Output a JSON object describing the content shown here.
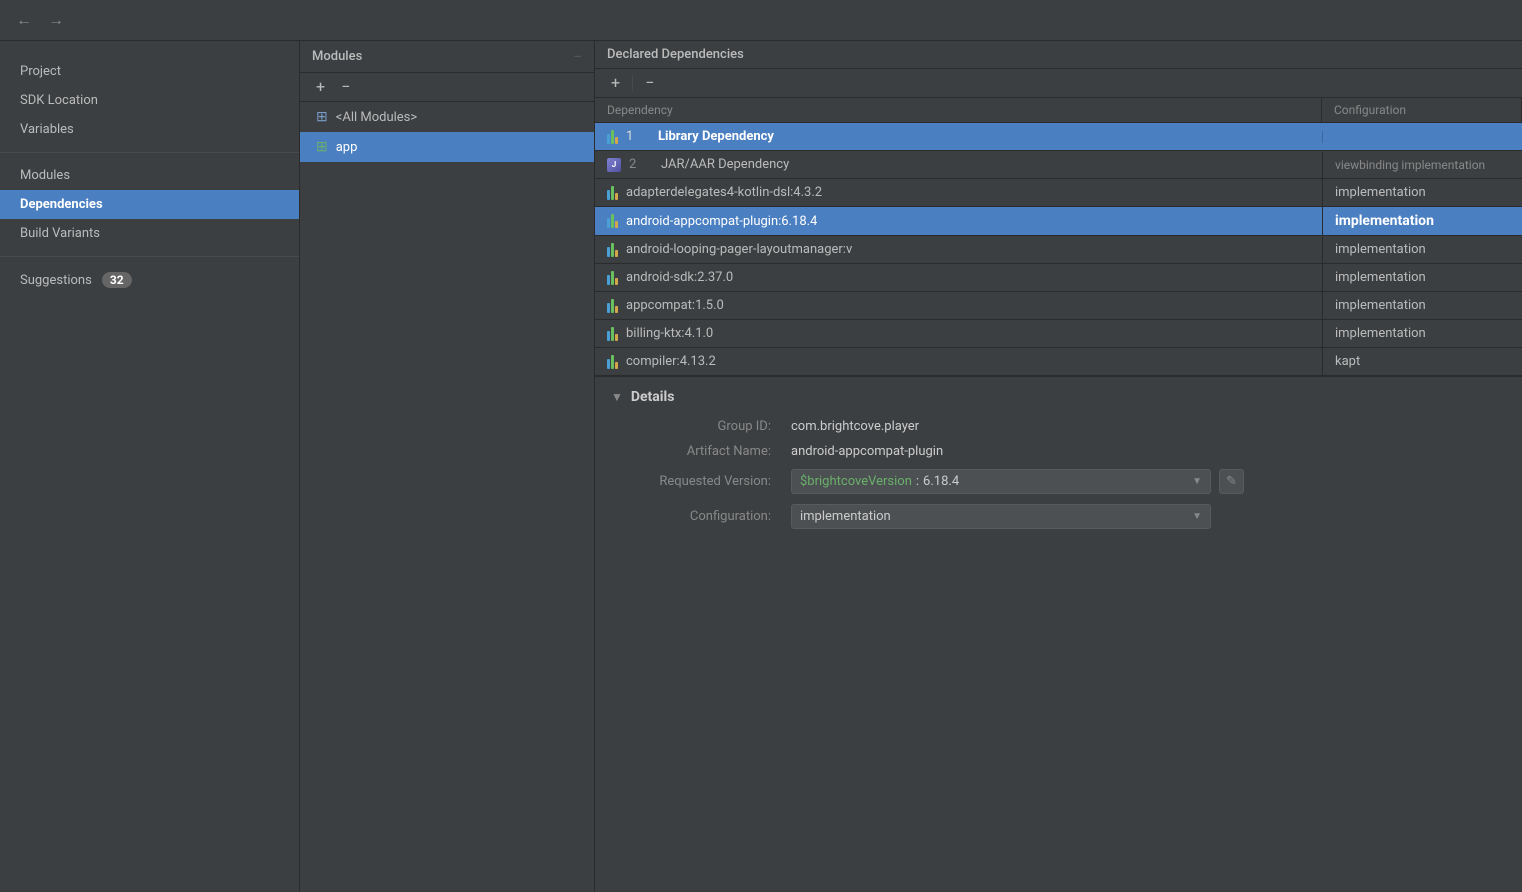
{
  "nav": {
    "back_label": "←",
    "forward_label": "→"
  },
  "sidebar": {
    "items": [
      {
        "id": "project",
        "label": "Project",
        "active": false
      },
      {
        "id": "sdk-location",
        "label": "SDK Location",
        "active": false
      },
      {
        "id": "variables",
        "label": "Variables",
        "active": false
      },
      {
        "id": "modules",
        "label": "Modules",
        "active": false
      },
      {
        "id": "dependencies",
        "label": "Dependencies",
        "active": true
      },
      {
        "id": "build-variants",
        "label": "Build Variants",
        "active": false
      }
    ],
    "suggestions_label": "Suggestions",
    "suggestions_count": "32"
  },
  "modules_panel": {
    "title": "Modules",
    "add_btn": "+",
    "remove_btn": "−",
    "items": [
      {
        "id": "all-modules",
        "label": "<All Modules>",
        "icon": "folder-all",
        "active": false
      },
      {
        "id": "app",
        "label": "app",
        "icon": "folder-app",
        "active": true
      }
    ]
  },
  "deps_panel": {
    "title": "Declared Dependencies",
    "add_btn": "+",
    "remove_btn": "−",
    "columns": {
      "dependency": "Dependency",
      "configuration": "Configuration"
    },
    "rows": [
      {
        "id": 1,
        "number": "1",
        "label": "Library Dependency",
        "type": "library",
        "config": "",
        "selected": false,
        "is_type_header": true
      },
      {
        "id": 2,
        "number": "2",
        "label": "JAR/AAR Dependency",
        "type": "jar",
        "config": "viewbinding  implementation",
        "selected": false,
        "is_type_header": true
      },
      {
        "id": 3,
        "number": "",
        "label": "adapterdelegates4-kotlin-dsl:4.3.2",
        "type": "bar",
        "config": "implementation",
        "selected": false
      },
      {
        "id": 4,
        "number": "",
        "label": "android-appcompat-plugin:6.18.4",
        "type": "bar",
        "config": "implementation",
        "selected": true
      },
      {
        "id": 5,
        "number": "",
        "label": "android-looping-pager-layoutmanager:v",
        "type": "bar",
        "config": "implementation",
        "selected": false
      },
      {
        "id": 6,
        "number": "",
        "label": "android-sdk:2.37.0",
        "type": "bar",
        "config": "implementation",
        "selected": false
      },
      {
        "id": 7,
        "number": "",
        "label": "appcompat:1.5.0",
        "type": "bar",
        "config": "implementation",
        "selected": false
      },
      {
        "id": 8,
        "number": "",
        "label": "billing-ktx:4.1.0",
        "type": "bar",
        "config": "implementation",
        "selected": false
      },
      {
        "id": 9,
        "number": "",
        "label": "compiler:4.13.2",
        "type": "bar",
        "config": "kapt",
        "selected": false
      }
    ]
  },
  "details": {
    "section_title": "Details",
    "group_id_label": "Group ID:",
    "group_id_value": "com.brightcove.player",
    "artifact_name_label": "Artifact Name:",
    "artifact_name_value": "android-appcompat-plugin",
    "requested_version_label": "Requested Version:",
    "requested_version_var": "$brightcoveVersion",
    "requested_version_separator": " : ",
    "requested_version_literal": "6.18.4",
    "configuration_label": "Configuration:",
    "configuration_value": "implementation"
  }
}
